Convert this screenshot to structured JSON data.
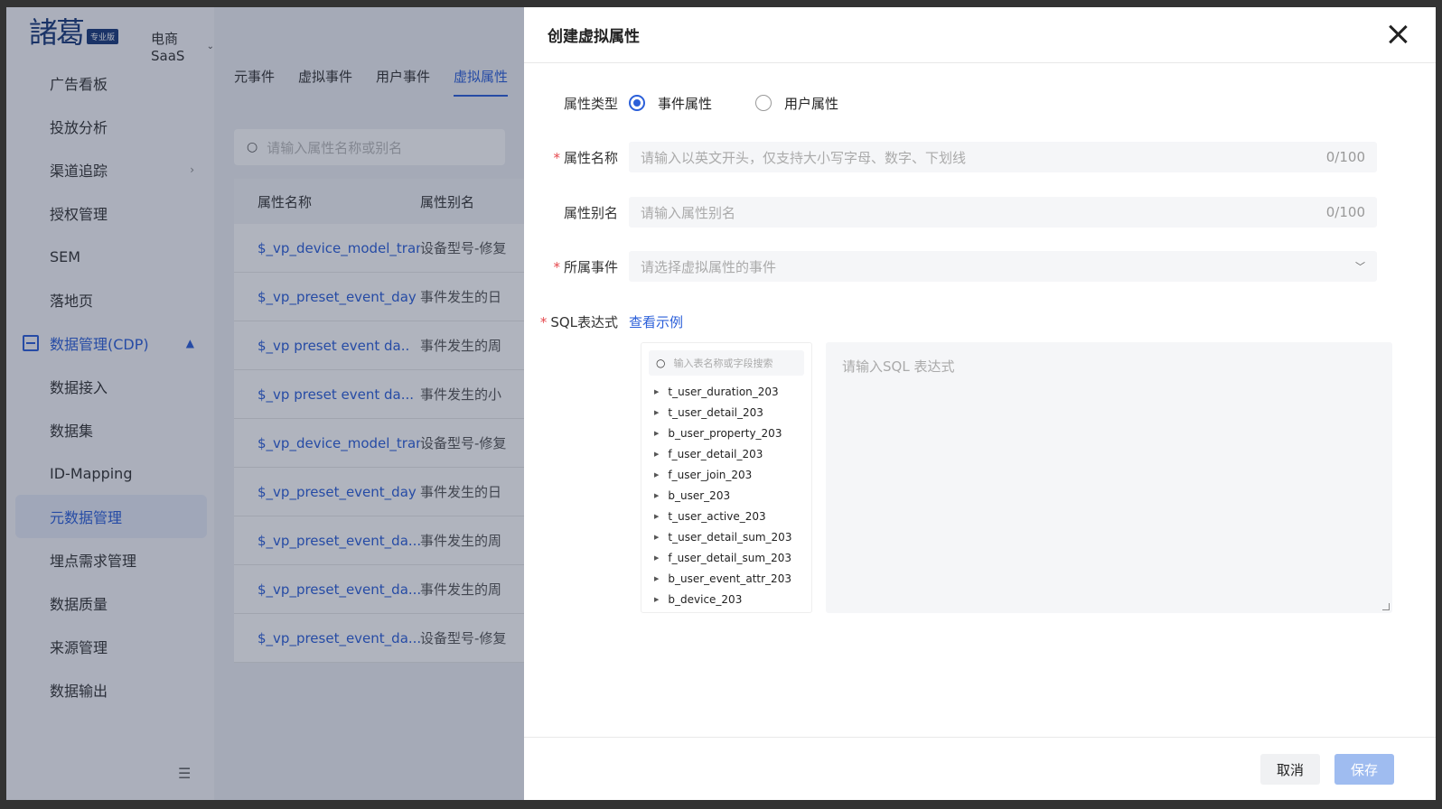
{
  "sidebar": {
    "logo": "諸葛",
    "logo_badge": "专业版",
    "app_name": "电商SaaS",
    "items": [
      {
        "label": "广告看板"
      },
      {
        "label": "投放分析"
      },
      {
        "label": "渠道追踪"
      },
      {
        "label": "授权管理"
      },
      {
        "label": "SEM"
      },
      {
        "label": "落地页"
      },
      {
        "label": "数据管理(CDP)"
      },
      {
        "label": "数据接入"
      },
      {
        "label": "数据集"
      },
      {
        "label": "ID-Mapping"
      },
      {
        "label": "元数据管理"
      },
      {
        "label": "埋点需求管理"
      },
      {
        "label": "数据质量"
      },
      {
        "label": "来源管理"
      },
      {
        "label": "数据输出"
      }
    ]
  },
  "main": {
    "tabs": [
      "元事件",
      "虚拟事件",
      "用户事件",
      "虚拟属性"
    ],
    "search_placeholder": "请输入属性名称或别名",
    "table": {
      "headers": [
        "属性名称",
        "属性别名"
      ],
      "rows": [
        [
          "$_vp_device_model_tran",
          "设备型号-修复"
        ],
        [
          "$_vp_preset_event_day",
          "事件发生的日"
        ],
        [
          "$_vp preset event da..",
          "事件发生的周"
        ],
        [
          "$_vp preset event da...",
          "事件发生的小"
        ],
        [
          "$_vp_device_model_tran",
          "设备型号-修复"
        ],
        [
          "$_vp_preset_event_day",
          "事件发生的日"
        ],
        [
          "$_vp_preset_event_da...",
          "事件发生的周"
        ],
        [
          "$_vp_preset_event_da...",
          "事件发生的周"
        ],
        [
          "$_vp_preset_event_da...",
          "设备型号-修复"
        ]
      ]
    }
  },
  "drawer": {
    "title": "创建虚拟属性",
    "attr_type": {
      "label": "属性类型",
      "options": [
        "事件属性",
        "用户属性"
      ],
      "selected": "事件属性"
    },
    "attr_name": {
      "label": "属性名称",
      "placeholder": "请输入以英文开头，仅支持大小写字母、数字、下划线",
      "count": "0/100"
    },
    "attr_alias": {
      "label": "属性别名",
      "placeholder": "请输入属性别名",
      "count": "0/100"
    },
    "event": {
      "label": "所属事件",
      "placeholder": "请选择虚拟属性的事件"
    },
    "sql": {
      "label": "SQL表达式",
      "example_link": "查看示例",
      "tree_search_placeholder": "输入表名称或字段搜索",
      "tables": [
        "t_user_duration_203",
        "t_user_detail_203",
        "b_user_property_203",
        "f_user_detail_203",
        "f_user_join_203",
        "b_user_203",
        "t_user_active_203",
        "t_user_detail_sum_203",
        "f_user_detail_sum_203",
        "b_user_event_attr_203",
        "b_device_203"
      ],
      "placeholder": "请输入SQL 表达式"
    },
    "footer": {
      "cancel": "取消",
      "save": "保存"
    }
  },
  "colors": {
    "primary": "#2b5fd9",
    "required": "#e5484d",
    "save_disabled": "#9fbcf0"
  }
}
